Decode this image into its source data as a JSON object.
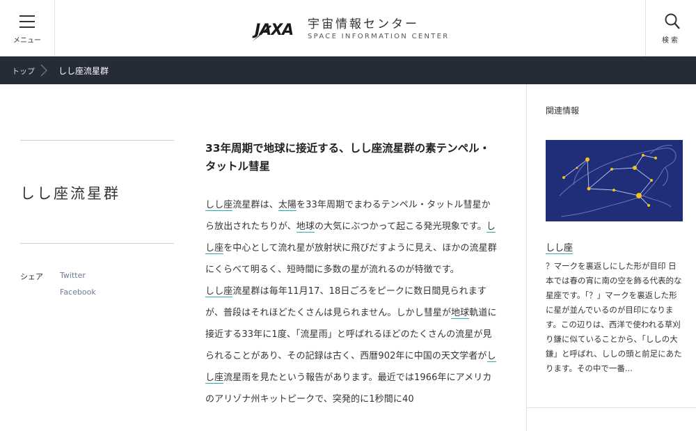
{
  "header": {
    "menu_label": "メニュー",
    "search_label": "検索",
    "logo_mark": "JAXA",
    "title_jp": "宇宙情報センター",
    "title_en": "SPACE INFORMATION CENTER"
  },
  "breadcrumb": {
    "top": "トップ",
    "current": "しし座流星群"
  },
  "page": {
    "title": "しし座流星群"
  },
  "share": {
    "label": "シェア",
    "twitter": "Twitter",
    "facebook": "Facebook"
  },
  "article": {
    "heading": "33年周期で地球に接近する、しし座流星群の素テンペル・タットル彗星",
    "p1": [
      {
        "t": "しし座",
        "link": true
      },
      {
        "t": "流星群は、"
      },
      {
        "t": "太陽",
        "link": true
      },
      {
        "t": "を33年周期でまわるテンペル・タットル彗星から放出されたちりが、"
      },
      {
        "t": "地球",
        "link": true
      },
      {
        "t": "の大気にぶつかって起こる発光現象です。"
      },
      {
        "t": "しし座",
        "link": true
      },
      {
        "t": "を中心として流れ星が放射状に飛びだすように見え、ほかの流星群にくらべて明るく、短時間に多数の星が流れるのが特徴です。"
      }
    ],
    "p2": [
      {
        "t": "しし座",
        "link": true
      },
      {
        "t": "流星群は毎年11月17、18日ごろをピークに数日間見られますが、普段はそれほどたくさんは見られません。しかし彗星が"
      },
      {
        "t": "地球",
        "link": true
      },
      {
        "t": "軌道に接近する33年に1度、「流星雨」と呼ばれるほどのたくさんの流星が見られることがあり、その記録は古く、西暦902年に中国の天文学者が"
      },
      {
        "t": "しし座",
        "link": true
      },
      {
        "t": "流星雨を見たという報告があります。最近では1966年にアメリカのアリゾナ州キットピークで、突発的に1秒間に40"
      }
    ]
  },
  "sidebar": {
    "heading": "関連情報",
    "item_title": "しし座",
    "item_desc": "？マークを裏返しにした形が目印 日本では春の宵に南の空を飾る代表的な星座です。「？」マークを裏返した形に星が並んでいるのが目印になります。この辺りは、西洋で使われる草刈り鎌に似ていることから、「ししの大鎌」と呼ばれ、ししの頭と前足にあたります。その中で一番..."
  },
  "colors": {
    "breadcrumb_bg": "#262b38",
    "link_underline": "#2aa9b9",
    "thumb_bg": "#202e7a",
    "star": "#f2c21a"
  }
}
